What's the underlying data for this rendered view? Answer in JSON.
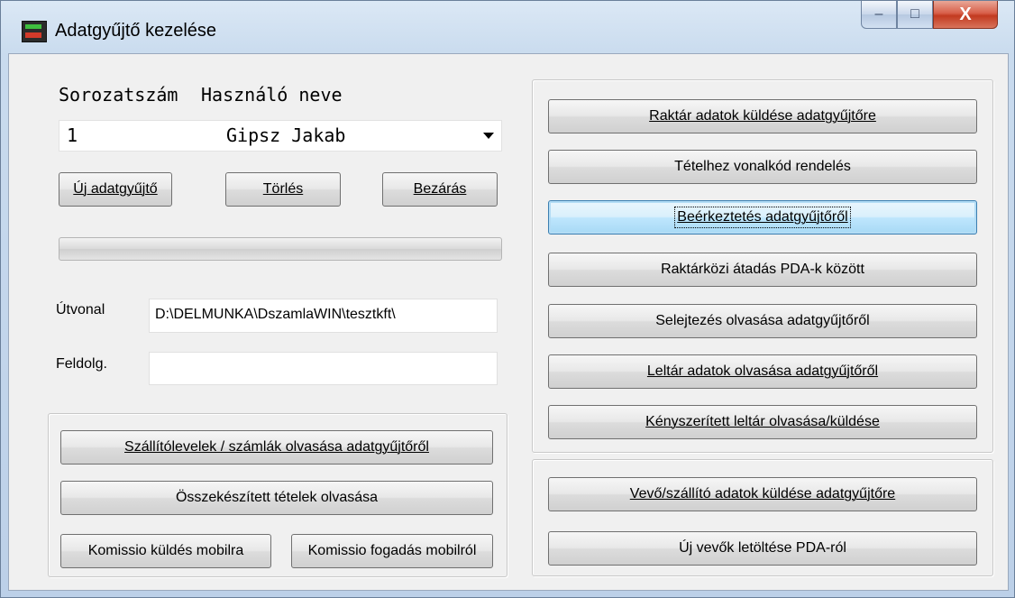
{
  "window": {
    "title": "Adatgyűjtő kezelése",
    "controls": {
      "minimize": "–",
      "maximize": "□",
      "close": "X"
    }
  },
  "header": {
    "serial_label": "Sorozatszám",
    "user_label": "Használó neve"
  },
  "device_combo": {
    "serial": "1",
    "user_name": "Gipsz Jakab"
  },
  "device_buttons": {
    "new": "Új adatgyűjtő",
    "delete": "Törlés",
    "close": "Bezárás"
  },
  "progress": {
    "value_percent": 0
  },
  "paths": {
    "path_label": "Útvonal",
    "path_value": "D:\\DELMUNKA\\DszamlaWIN\\tesztkft\\",
    "process_label": "Feldolg.",
    "process_value": ""
  },
  "left_actions": {
    "read_delivery_notes": "Szállítólevelek / számlák olvasása adatgyűjtőről",
    "read_assembled_items": "Összekészített tételek olvasása",
    "send_commission": "Komissio küldés mobilra",
    "receive_commission": "Komissio fogadás mobilról"
  },
  "right_actions": {
    "send_stock": "Raktár adatok küldése adatgyűjtőre",
    "assign_barcode": "Tételhez vonalkód rendelés",
    "receive_goods": "Beérkeztetés adatgyűjtőről",
    "transfer_pda": "Raktárközi átadás PDA-k között",
    "read_scrapping": "Selejtezés olvasása adatgyűjtőről",
    "read_inventory": "Leltár adatok olvasása adatgyűjtőről",
    "forced_inventory": "Kényszerített leltár olvasása/küldése",
    "send_partners": "Vevő/szállító adatok küldése adatgyűjtőre",
    "download_customers": "Új vevők letöltése PDA-ról"
  }
}
